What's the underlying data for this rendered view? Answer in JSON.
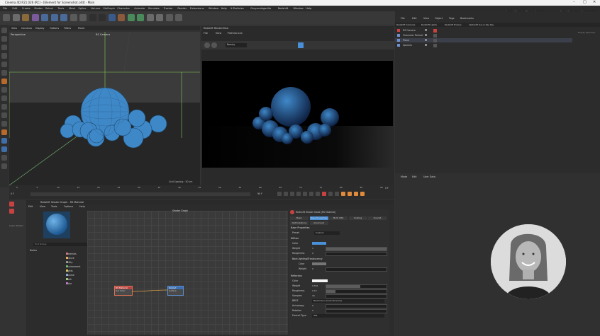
{
  "window": {
    "title": "Cinema 4D R21.026 (RC) - [Element for Screenshot.c4d] - Main",
    "controls": [
      "–",
      "□",
      "✕"
    ]
  },
  "menu": [
    "File",
    "Edit",
    "Create",
    "Modes",
    "Select",
    "Tools",
    "Mesh",
    "Spline",
    "Volume",
    "MoGraph",
    "Character",
    "Animate",
    "Simulate",
    "Tracker",
    "Render",
    "Extensions",
    "Window",
    "Help",
    "X-Particles",
    "Greyscalegorilla",
    "Redshift",
    "Window",
    "Help"
  ],
  "node_space": {
    "label": "Node Space:",
    "value": "Current (Standard/Physical)"
  },
  "layout": {
    "label": "Layout:",
    "value": "Redshift_rebpand (User)"
  },
  "viewport": {
    "menu": [
      "View",
      "Cameras",
      "Display",
      "Options",
      "Filters",
      "Panel"
    ],
    "label": "Perspective",
    "camera": "RS Camera",
    "grid": "Grid Spacing : 50 cm"
  },
  "renderview": {
    "title": "Redshift RenderView",
    "menu": [
      "File",
      "View",
      "Preferences"
    ],
    "beauty": "Beauty"
  },
  "timeline": {
    "ticks": [
      "0",
      "5",
      "10",
      "15",
      "20",
      "25",
      "30",
      "35",
      "40",
      "45",
      "50",
      "55",
      "60",
      "65",
      "70",
      "75",
      "80",
      "85",
      "90"
    ],
    "start": "0 F",
    "end": "90 F",
    "current": "0 F"
  },
  "object_manager": {
    "menu": [
      "File",
      "Edit",
      "View",
      "Object",
      "Tags",
      "Bookmarks"
    ],
    "tabs": [
      "Redshift Cameras",
      "Redshift Lights",
      "Redshift Proxies",
      "Redshift Sun & Sky Rig"
    ],
    "objects": [
      "RS Camera",
      "Character Portrait",
      "Plane",
      "Spheres"
    ],
    "search": "Empty Selection"
  },
  "attributes": {
    "menu": [
      "Mode",
      "Edit",
      "User Data"
    ]
  },
  "material_preview": {
    "label": "Layer Shader"
  },
  "shader_graph": {
    "title": "Redshift Shader Graph - RS Material",
    "menu": [
      "Edit",
      "View",
      "Tools",
      "Options",
      "Help"
    ],
    "canvas_title": "Shader Graph",
    "find": "Find Nodes",
    "tree_header": "Nodes",
    "categories": [
      "Materials",
      "Texture",
      "Utility",
      "Environment",
      "Lights",
      "Volume",
      "Math",
      "Color"
    ],
    "category_colors": [
      "#c0504d",
      "#e9a23b",
      "#7f7f7f",
      "#4aa34a",
      "#e0c040",
      "#6f8fcf",
      "#8fbf5f",
      "#b05fbf"
    ],
    "node_material": {
      "title": "RS Material",
      "port": "Out Color"
    },
    "node_output": {
      "title": "Output",
      "port": "Surface"
    }
  },
  "properties": {
    "title": "Redshift Shader Node [RS Material]",
    "tabs": [
      "Basic",
      "Base Properties",
      "Multi (3D)",
      "Coating",
      "Overall"
    ],
    "subtabs": [
      "Optimizations",
      "Advanced"
    ],
    "section": "Base Properties",
    "preset_label": "Preset",
    "preset_value": "Custom",
    "diffuse": "Diffuse",
    "backlighting": "Back-lighting/Translucency",
    "reflection": "Reflection",
    "rows": {
      "color": "Color",
      "weight": "Weight",
      "roughness": "Roughness",
      "samples": "Samples",
      "brdf": "BRDF",
      "anisotropy": "Anisotropy",
      "rotation": "Rotation",
      "fresnel": "Fresnel Type"
    },
    "values": {
      "diffuse_weight": "1",
      "diffuse_rough": "0",
      "bl_weight": "0",
      "refl_weight": "0.561",
      "refl_rough": "0.15",
      "samples": "16",
      "brdf": "Beckmann (Cook-Torrance)",
      "anisotropy": "0",
      "rotation": "0",
      "fresnel": "IOR"
    },
    "fills": {
      "diffuse_weight": 1.0,
      "refl_weight": 0.56,
      "refl_rough": 0.15
    }
  },
  "colors": {
    "sphere": "#3f88c8",
    "accent": "#4a90d9",
    "node_red": "#b84646",
    "node_blue": "#3e6fb0"
  }
}
